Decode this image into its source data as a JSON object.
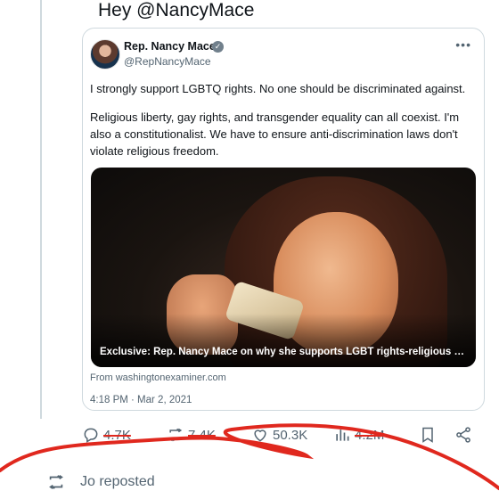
{
  "reply": {
    "text": "Hey @NancyMace"
  },
  "quoted_tweet": {
    "display_name": "Rep. Nancy Mace",
    "handle": "@RepNancyMace",
    "verified": true,
    "paragraphs": [
      "I strongly support LGBTQ rights. No one should be discriminated against.",
      "Religious liberty, gay rights, and transgender equality can all coexist. I'm also a constitutionalist. We have to ensure anti-discrimination laws don't violate religious freedom."
    ],
    "media_caption": "Exclusive: Rep. Nancy Mace on why she supports LGBT rights-religious liberty compro...",
    "link_source": "From washingtonexaminer.com",
    "timestamp": "4:18 PM · Mar 2, 2021"
  },
  "actions": {
    "replies": "4.7K",
    "reposts": "7.4K",
    "likes": "50.3K",
    "views": "4.2M"
  },
  "repost_notice": {
    "text": "Jo reposted"
  },
  "colors": {
    "text": "#0f1419",
    "secondary": "#536471",
    "border": "#cfd9de",
    "annotation": "#e0281e"
  }
}
